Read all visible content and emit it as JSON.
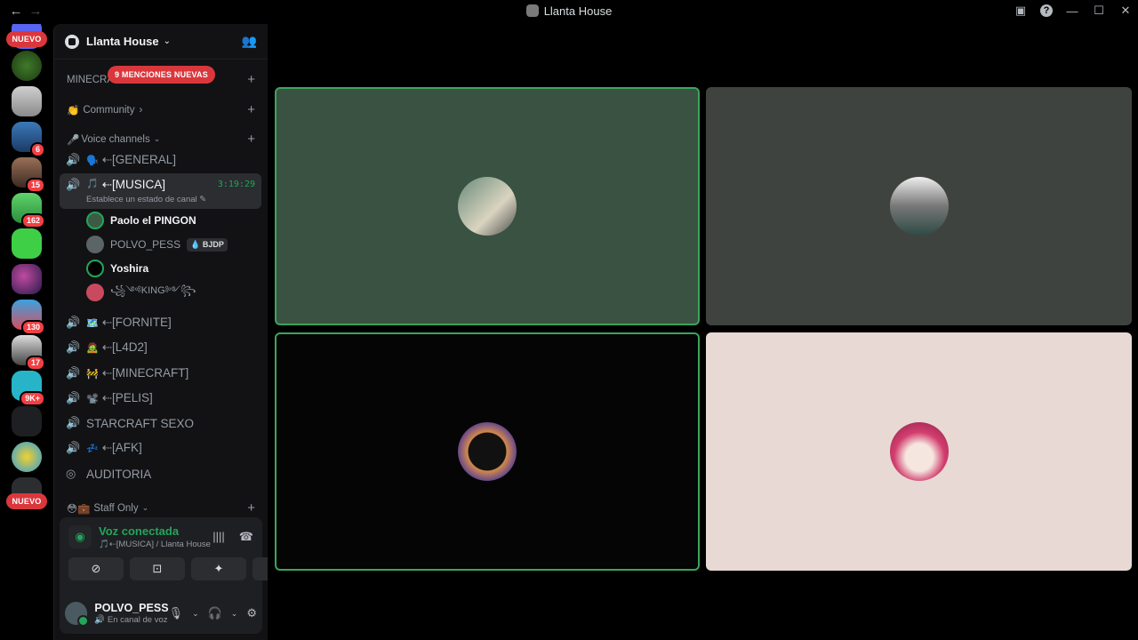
{
  "titlebar": {
    "back_icon": "←",
    "forward_icon": "→",
    "title": "Llanta House",
    "inbox_icon": "▣",
    "help_icon": "?",
    "minimize_icon": "—",
    "maximize_icon": "☐",
    "close_icon": "✕"
  },
  "guilds": {
    "new_label_top": "NUEVO",
    "new_label_bottom": "NUEVO",
    "badges": [
      "6",
      "15",
      "162",
      "130",
      "17",
      "9K+"
    ]
  },
  "server": {
    "name": "Llanta House",
    "chevron": "⌄",
    "invite_icon": "⁺"
  },
  "mentions_pill": "9 MENCIONES NUEVAS",
  "categories": {
    "minecraft": "MINECRA",
    "community": "Community",
    "community_emoji": "👏",
    "community_chev": "›",
    "voice": "Voice channels",
    "voice_emoji": "🎤",
    "voice_chev": "⌄",
    "staff": "Staff Only",
    "staff_emoji": "😳💼",
    "staff_chev": "⌄",
    "plus": "+"
  },
  "channels": [
    {
      "emoji": "🗣️",
      "name": "⇠[GENERAL]"
    },
    {
      "emoji": "🎵",
      "name": "⇠[MUSICA]",
      "timer": "3:19:29",
      "status": "Establece un estado de canal ✎"
    },
    {
      "emoji": "🗺️",
      "name": "⇠[FORNITE]"
    },
    {
      "emoji": "🧟",
      "name": "⇠[L4D2]"
    },
    {
      "emoji": "🚧",
      "name": "⇠[MINECRAFT]"
    },
    {
      "emoji": "📽️",
      "name": "⇠[PELIS]"
    },
    {
      "emoji": "",
      "name": "STARCRAFT SEXO"
    },
    {
      "emoji": "💤",
      "name": "⇠[AFK]"
    },
    {
      "emoji": "",
      "name": "AUDITORIA"
    }
  ],
  "members": [
    {
      "name": "Paolo el PINGON"
    },
    {
      "name": "POLVO_PESS",
      "tag": "💧 BJDP"
    },
    {
      "name": "Yoshira"
    },
    {
      "name": "꧁༺KING༻꧂"
    }
  ],
  "voice_panel": {
    "title": "Voz conectada",
    "subtitle": "🎵⇠[MUSICA] / Llanta House",
    "signal_icon": "◉",
    "noise_icon": "||||",
    "disconnect_icon": "☎",
    "buttons": [
      "⊘",
      "⊡",
      "✦",
      "⚹"
    ]
  },
  "user": {
    "name": "POLVO_PESS",
    "status": "🔊 En canal de voz",
    "mic_icon": "🎙",
    "headphones_icon": "🎧",
    "settings_icon": "⚙",
    "chev": "⌄"
  },
  "colors": {
    "accent_green": "#23a55a",
    "speaking_border": "#3ba55c",
    "mention_red": "#da373c"
  }
}
